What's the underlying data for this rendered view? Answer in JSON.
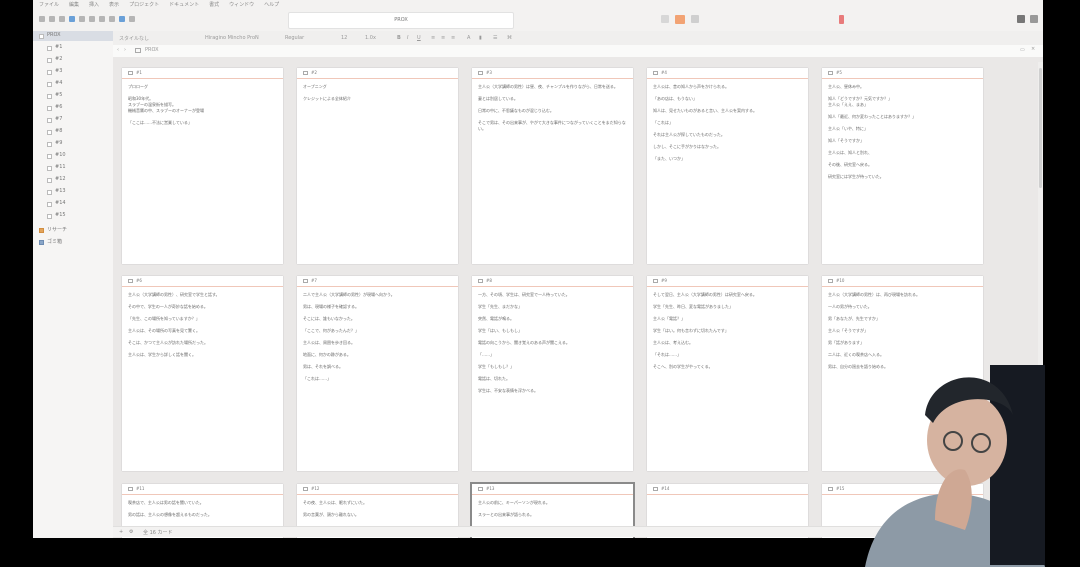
{
  "app": {
    "menu": [
      "ファイル",
      "編集",
      "挿入",
      "表示",
      "プロジェクト",
      "ドキュメント",
      "書式",
      "ウィンドウ",
      "ヘルプ"
    ],
    "document_title": "PROX",
    "path_label": "PROX",
    "status_text": "全 16 カード"
  },
  "format_bar": {
    "style_label": "スタイルなし",
    "font_name": "Hiragino Mincho ProN",
    "font_weight": "Regular",
    "font_size": "12",
    "line_spacing": "1.0x"
  },
  "sidebar": {
    "items": [
      {
        "label": "PROX"
      },
      {
        "label": "#1"
      },
      {
        "label": "#2"
      },
      {
        "label": "#3"
      },
      {
        "label": "#4"
      },
      {
        "label": "#5"
      },
      {
        "label": "#6"
      },
      {
        "label": "#7"
      },
      {
        "label": "#8"
      },
      {
        "label": "#9"
      },
      {
        "label": "#10"
      },
      {
        "label": "#11"
      },
      {
        "label": "#12"
      },
      {
        "label": "#13"
      },
      {
        "label": "#14"
      },
      {
        "label": "#15"
      },
      {
        "label": "リサーチ"
      },
      {
        "label": "ゴミ箱"
      }
    ]
  },
  "cards": [
    {
      "title": "#1",
      "body": "プロローグ\n\n昭和30年代。\nスラブーの温泉街を描写。\n機械音響の中、スラブーのオーナーが登場\n\n「ここは……不法に営業している」"
    },
    {
      "title": "#2",
      "body": "オープニング\n\nクレジットによる全体紹介"
    },
    {
      "title": "#3",
      "body": "主人公（大学講師の男性）は昼、夜、チャンプルを作りながら、日常を送る。\n\n妻とは別居している。\n\n日常の中に、不思議なものが混じり込む。\n\nそこで男は、その出来事が、やがて大きな事件につながっていくことをまだ知らない。"
    },
    {
      "title": "#4",
      "body": "主人公は、昔の知人から声をかけられる。\n\n「あの店は、もうない」\n\n知人は、見せたいものがあると言い、主人公を案内する。\n\n「これは」\n\nそれは主人公が探していたものだった。\n\nしかし、そこに手がかりはなかった。\n\n「また、いつか」"
    },
    {
      "title": "#5",
      "body": "主人公、昼休み中。\n\n知人「どうですか？元気ですか？」\n主人公「ええ、まあ」\n\n知人「最近、何か変わったことはありますか？」\n\n主人公「いや、特に」\n\n知人「そうですか」\n\n主人公は、知人と別れ、\n\nその後、研究室へ戻る。\n\n研究室には学生が待っていた。"
    },
    {
      "title": "#6",
      "body": "主人公（大学講師の男性）、研究室で学生と話す。\n\nその中で、学生の一人が奇妙な話を始める。\n\n「先生、この場所を知っていますか？」\n\n主人公は、その場所の写真を見て驚く。\n\nそこは、かつて主人公が訪れた場所だった。\n\n主人公は、学生から詳しく話を聞く。"
    },
    {
      "title": "#7",
      "body": "二人で主人公（大学講師の男性）が現場へ向かう。\n\n男は、現場の様子を確認する。\n\nそこには、誰もいなかった。\n\n「ここで、何があったんだ？」\n\n主人公は、周囲を歩き回る。\n\n地面に、何かの跡がある。\n\n男は、それを調べる。\n\n「これは……」"
    },
    {
      "title": "#8",
      "body": "一方、その頃、学生は、研究室で一人待っていた。\n\n学生「先生、まだかな」\n\n突然、電話が鳴る。\n\n学生「はい、もしもし」\n\n電話の向こうから、聞き覚えのある声が聞こえる。\n\n「……」\n\n学生「もしもし？」\n\n電話は、切れた。\n\n学生は、不安な表情を浮かべる。"
    },
    {
      "title": "#9",
      "body": "そして翌日、主人公（大学講師の男性）は研究室へ戻る。\n\n学生「先生、昨日、変な電話がありました」\n\n主人公「電話？」\n\n学生「はい。何も言わずに切れたんです」\n\n主人公は、考え込む。\n\n「それは……」\n\nそこへ、別の学生がやってくる。"
    },
    {
      "title": "#10",
      "body": "主人公（大学講師の男性）は、再び現場を訪れる。\n\n一人の男が待っていた。\n\n男「あなたが、先生ですか」\n\n主人公「そうですが」\n\n男「話があります」\n\n二人は、近くの喫茶店へ入る。\n\n男は、自分の過去を語り始める。"
    },
    {
      "title": "#11",
      "body": "喫茶店で、主人公は男の話を聞いていた。\n\n男の話は、主人公の想像を超えるものだった。"
    },
    {
      "title": "#12",
      "body": "その夜、主人公は、眠れずにいた。\n\n男の言葉が、頭から離れない。"
    },
    {
      "title": "#13",
      "body": "主人公の前に、キーパーソンが現れる。\n\nスラーとの出来事が語られる。"
    },
    {
      "title": "#14",
      "body": ""
    },
    {
      "title": "#15",
      "body": ""
    }
  ]
}
